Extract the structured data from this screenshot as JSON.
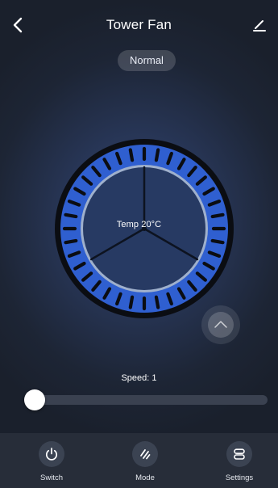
{
  "header": {
    "title": "Tower Fan",
    "back_icon": "chevron-left-icon",
    "edit_icon": "pencil-icon"
  },
  "mode_badge": {
    "label": "Normal"
  },
  "dial": {
    "temp_label": "Temp 20°C",
    "accent_color": "#2f5fd0",
    "tick_count": 36
  },
  "swing": {
    "icon": "chevron-up-icon"
  },
  "speed": {
    "label": "Speed: 1",
    "level_fraction": 0.0
  },
  "nav": {
    "items": [
      {
        "label": "Switch",
        "icon": "power-icon"
      },
      {
        "label": "Mode",
        "icon": "mode-slash-icon"
      },
      {
        "label": "Settings",
        "icon": "settings-toggle-icon"
      }
    ]
  },
  "colors": {
    "background": "#1c2230",
    "bottom_bar": "#272d39",
    "slider_track": "#3a4150"
  }
}
